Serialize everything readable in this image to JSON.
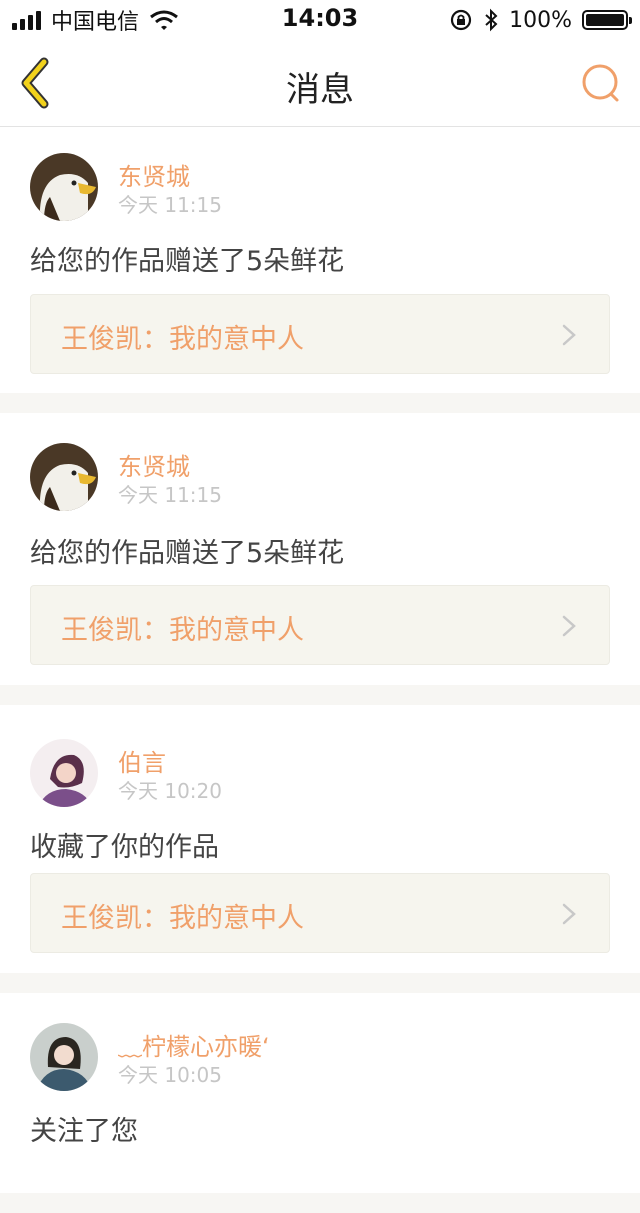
{
  "status_bar": {
    "carrier": "中国电信",
    "time": "14:03",
    "battery": "100%",
    "battery_level": 1.0
  },
  "nav": {
    "title": "消息",
    "back_icon": "chevron-left-icon",
    "search_icon": "search-icon"
  },
  "colors": {
    "accent": "#f0a06a",
    "back_icon": "#f2d21c",
    "card_bg": "#f6f5ee",
    "page_bg": "#f7f6f3"
  },
  "messages": [
    {
      "name": "东贤城",
      "time": "今天 11:15",
      "action": "给您的作品赠送了5朵鲜花",
      "work": "王俊凯：我的意中人"
    },
    {
      "name": "东贤城",
      "time": "今天 11:15",
      "action": "给您的作品赠送了5朵鲜花",
      "work": "王俊凯：我的意中人"
    },
    {
      "name": "伯言",
      "time": "今天 10:20",
      "action": "收藏了你的作品",
      "work": "王俊凯：我的意中人"
    },
    {
      "name": "﹏柠檬心亦暖‘",
      "time": "今天 10:05",
      "action": "关注了您"
    }
  ]
}
